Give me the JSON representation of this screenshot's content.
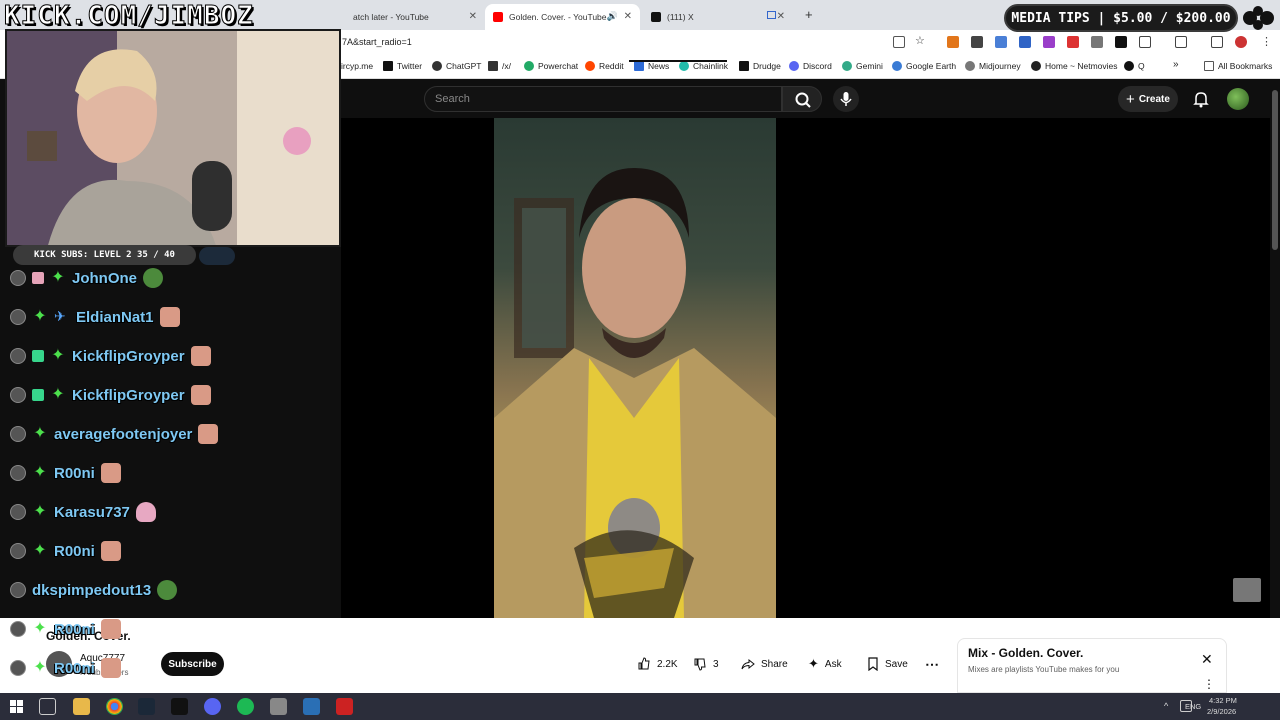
{
  "overlay": {
    "logo_text": "KICK.COM/JIMBOZ",
    "media_tips": "MEDIA TIPS | $5.00 / $200.00",
    "kick_subs": "KICK SUBS: LEVEL 2 35 / 40"
  },
  "tabs": [
    {
      "label": "atch later - YouTube"
    },
    {
      "label": "Golden. Cover. - YouTube"
    },
    {
      "label": "(111) X"
    }
  ],
  "address": {
    "url": "7A&start_radio=1"
  },
  "bookmarks": [
    {
      "label": "ircyp.me"
    },
    {
      "label": "Twitter"
    },
    {
      "label": "ChatGPT"
    },
    {
      "label": "/x/"
    },
    {
      "label": "Powerchat"
    },
    {
      "label": "Reddit"
    },
    {
      "label": "News"
    },
    {
      "label": "Chainlink"
    },
    {
      "label": "Drudge"
    },
    {
      "label": "Discord"
    },
    {
      "label": "Gemini"
    },
    {
      "label": "Google Earth"
    },
    {
      "label": "Midjourney"
    },
    {
      "label": "Home ~ Netmovies"
    },
    {
      "label": "Q"
    },
    {
      "label": "All Bookmarks"
    }
  ],
  "youtube": {
    "search_placeholder": "Search",
    "create_label": "Create",
    "video_title": "Golden. Cover.",
    "channel_name": "Aquc7777",
    "channel_subs": "K subscribers",
    "subscribe_label": "Subscribe",
    "likes": "2.2K",
    "dislikes": "3",
    "share_label": "Share",
    "ask_label": "Ask",
    "save_label": "Save",
    "mix_title": "Mix - Golden. Cover.",
    "mix_subtitle": "Mixes are playlists YouTube makes for you"
  },
  "chat": [
    {
      "name": "JohnOne"
    },
    {
      "name": "EldianNat1"
    },
    {
      "name": "KickflipGroyper"
    },
    {
      "name": "KickflipGroyper"
    },
    {
      "name": "averagefootenjoyer"
    },
    {
      "name": "R00ni"
    },
    {
      "name": "Karasu737"
    },
    {
      "name": "R00ni"
    },
    {
      "name": "dkspimpedout13"
    },
    {
      "name": "R00ni"
    },
    {
      "name": "R00ni"
    }
  ],
  "taskbar": {
    "lang": "ENG",
    "time": "4:32 PM",
    "date": "2/9/2026"
  }
}
